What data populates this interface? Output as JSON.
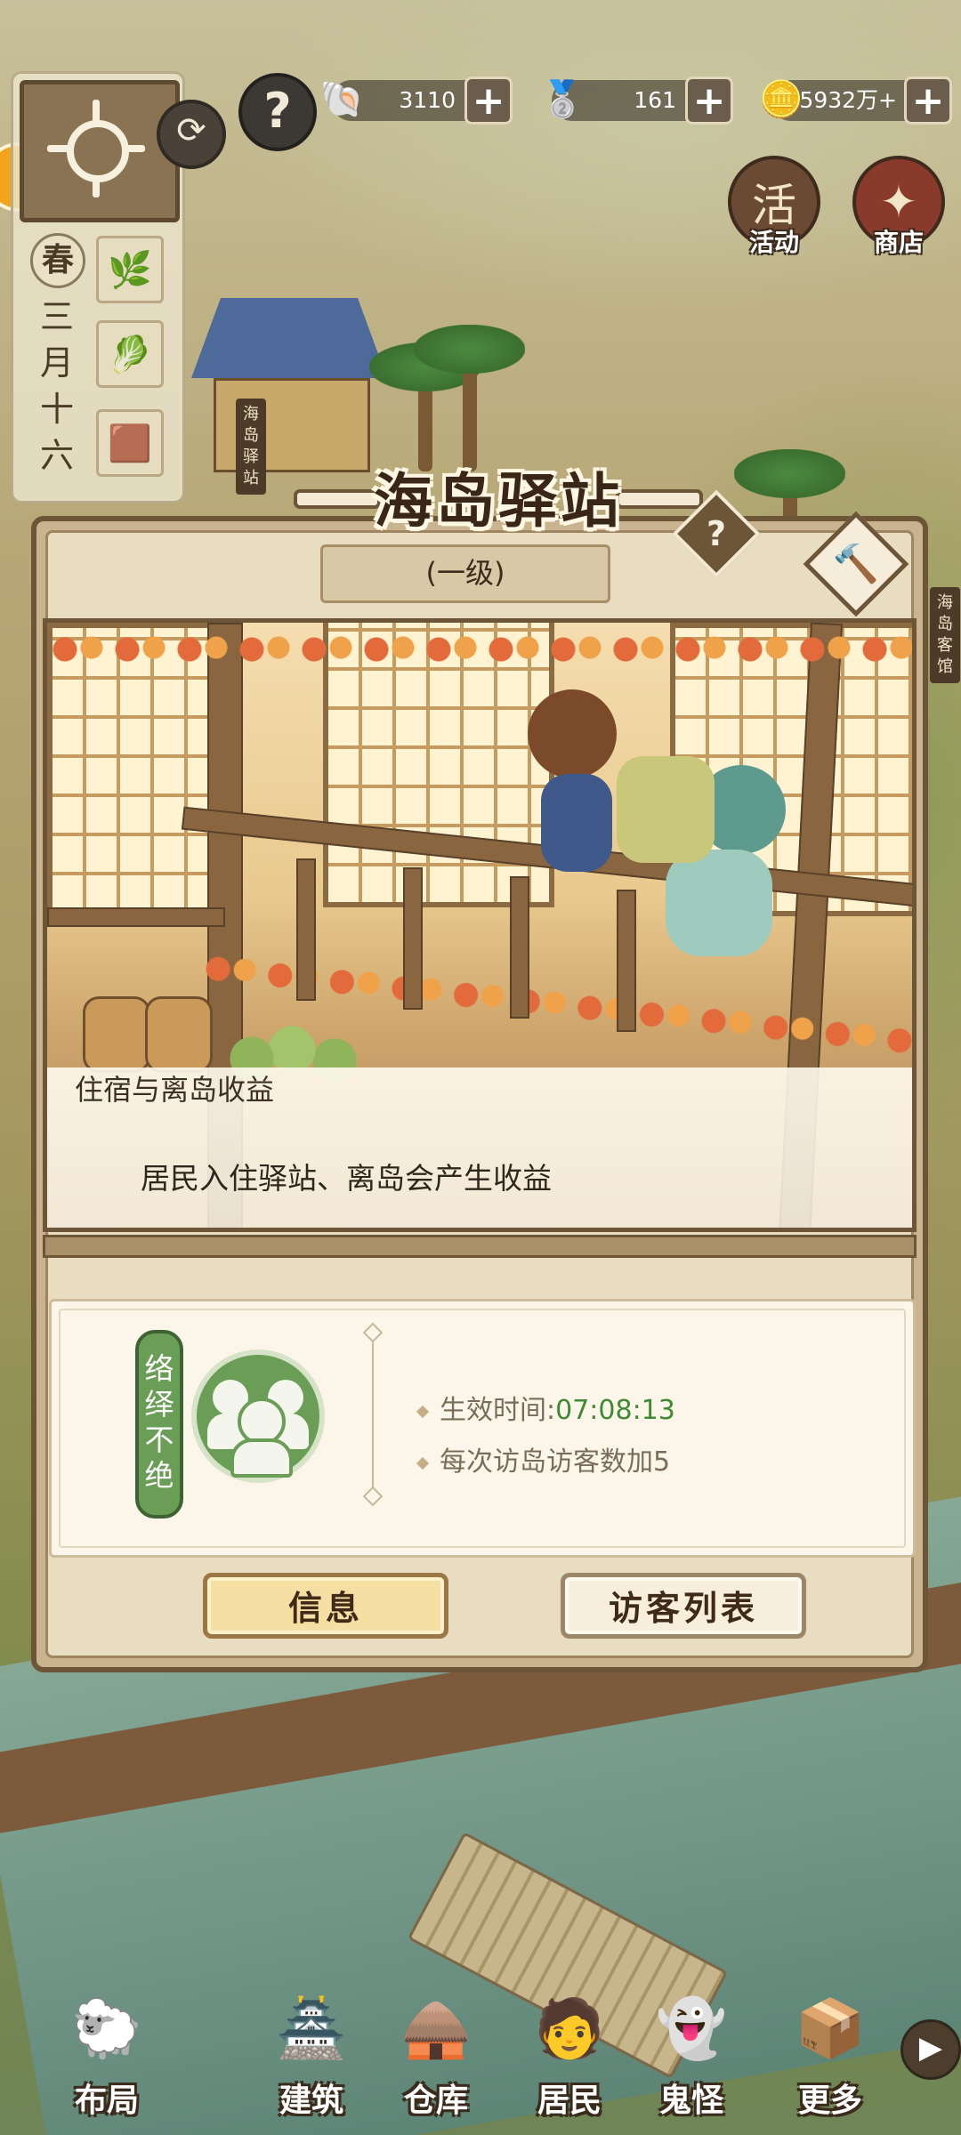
{
  "hud": {
    "season": "春",
    "date": "三月十六",
    "help_glyph": "?",
    "refresh_glyph": "⟳",
    "crops": [
      {
        "icon": "scallion-icon",
        "glyph": "🌿"
      },
      {
        "icon": "cabbage-icon",
        "glyph": "🥬"
      },
      {
        "icon": "seed-icon",
        "glyph": "🟫"
      }
    ]
  },
  "resources": [
    {
      "icon": "shell-icon",
      "glyph": "🐚",
      "value": "3110",
      "plus": "+"
    },
    {
      "icon": "silver-ingot-icon",
      "glyph": "🥈",
      "value": "161",
      "plus": "+"
    },
    {
      "icon": "copper-coin-icon",
      "glyph": "🪙",
      "value": "5932万+",
      "plus": "+"
    }
  ],
  "corner_buttons": {
    "activity": {
      "label": "活动",
      "glyph": "活"
    },
    "shop": {
      "label": "商店",
      "glyph": "✦"
    }
  },
  "map_signs": {
    "left": "海岛驿站",
    "right": "海岛客馆"
  },
  "modal": {
    "title": "海岛驿站",
    "level": "(一级)",
    "help_glyph": "?",
    "hammer_glyph": "🔨",
    "feature_title": "住宿与离岛收益",
    "feature_desc": "居民入住驿站、离岛会产生收益",
    "buff": {
      "tag": "络绎不绝",
      "time_label": "生效时间:",
      "time_value": "07:08:13",
      "effect": "每次访岛访客数加5"
    },
    "buttons": {
      "info": "信息",
      "visitor_list": "访客列表"
    }
  },
  "bottom_nav": [
    {
      "label": "布局",
      "glyph": "🐑"
    },
    {
      "label": "建筑",
      "glyph": "🏯"
    },
    {
      "label": "仓库",
      "glyph": "🛖"
    },
    {
      "label": "居民",
      "glyph": "🧑"
    },
    {
      "label": "鬼怪",
      "glyph": "👻"
    },
    {
      "label": "更多",
      "glyph": "📦"
    }
  ],
  "nav_arrow": "▶"
}
